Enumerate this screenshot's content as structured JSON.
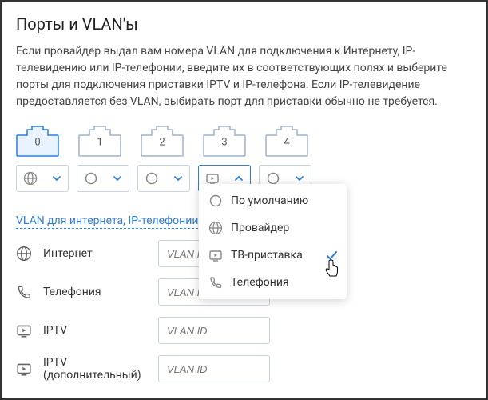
{
  "title": "Порты и VLAN'ы",
  "description": "Если провайдер выдал вам номера VLAN для подключения к Интернету, IP-телевидению или IP-телефонии, введите их в соответствующих полях и выберите порты для подключения приставки IPTV и IP-телефона. Если IP-телевидение предоставляется без VLAN, выбирать порт для приставки обычно не требуется.",
  "ports": [
    {
      "num": "0",
      "active": true
    },
    {
      "num": "1",
      "active": false
    },
    {
      "num": "2",
      "active": false
    },
    {
      "num": "3",
      "active": false
    },
    {
      "num": "4",
      "active": false
    }
  ],
  "selects": [
    {
      "icon": "globe",
      "open": false
    },
    {
      "icon": "circle",
      "open": false
    },
    {
      "icon": "circle",
      "open": false
    },
    {
      "icon": "tv",
      "open": true
    },
    {
      "icon": "circle",
      "open": false
    }
  ],
  "dropdown": {
    "items": [
      {
        "icon": "circle",
        "label": "По умолчанию",
        "selected": false
      },
      {
        "icon": "globe",
        "label": "Провайдер",
        "selected": false
      },
      {
        "icon": "tv",
        "label": "ТВ-приставка",
        "selected": true
      },
      {
        "icon": "phone",
        "label": "Телефония",
        "selected": false
      }
    ]
  },
  "section_link": "VLAN для интернета, IP-телефонии",
  "fields": [
    {
      "icon": "globe",
      "label": "Интернет",
      "placeholder": "VLAN ID"
    },
    {
      "icon": "phone",
      "label": "Телефония",
      "placeholder": "VLAN ID"
    },
    {
      "icon": "tv",
      "label": "IPTV",
      "placeholder": "VLAN ID"
    },
    {
      "icon": "tv",
      "label": "IPTV (дополнительный)",
      "placeholder": "VLAN ID"
    }
  ]
}
